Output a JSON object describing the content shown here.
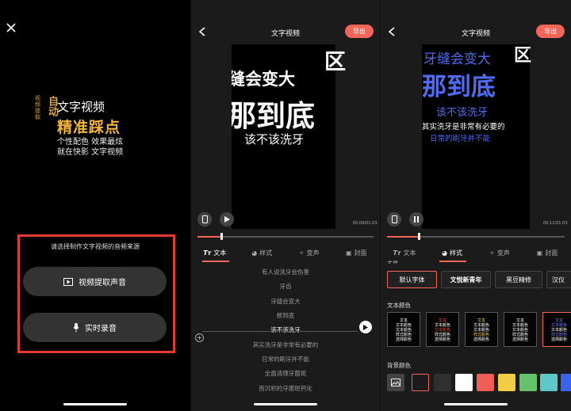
{
  "panel1": {
    "close_icon": "close-icon",
    "tag_small": "视频提取",
    "tag_logo": "自动",
    "headline1": "文字视频",
    "headline2": "精准踩点",
    "line3": "个性配色 效果最炫",
    "line4": "就在快影 文字视频",
    "hint": "请选择制作文字视频的音频来源",
    "btn_extract": "视频提取声音",
    "btn_record": "实时录音"
  },
  "editor": {
    "title": "文字视频",
    "export_label": "导出"
  },
  "panel2": {
    "preview_lines": [
      "缝会变大",
      "那到底",
      "该不该洗牙"
    ],
    "corner_char": "区",
    "time": "00:09/01:03",
    "tabs": [
      "文本",
      "样式",
      "变声",
      "封面"
    ],
    "lyrics": [
      "有人说洗牙会伤害",
      "牙齿",
      "牙缝会变大",
      "那到底",
      "该不该洗牙",
      "其实洗牙是非常有必要的",
      "日常的刷牙并不能",
      "全面清理牙菌斑",
      "而沉积的牙菌斑钙化"
    ],
    "current_lyric_index": 4
  },
  "panel3": {
    "preview_lines": [
      "牙缝会变大",
      "那到底",
      "该不该洗牙",
      "其实洗牙是非常有必要的",
      "日常的刷牙并不能"
    ],
    "corner_char": "区",
    "time": "00:11/01:03",
    "tabs": [
      "文本",
      "样式",
      "变声",
      "封面"
    ],
    "section_font_label": "字体",
    "fonts": [
      "默认字体",
      "文悦新青年",
      "黑豆精修",
      "汉仪"
    ],
    "section_color_label": "文本颜色",
    "color_swatch_text": [
      "文本",
      "文本颜色",
      "文本颜色",
      "样式颜色",
      "选择颜色"
    ],
    "section_bg_label": "背景颜色",
    "bg_colors": [
      "#000000",
      "#2f2f2f",
      "#ffffff",
      "#ef5d54",
      "#f1cd45",
      "#66c26a",
      "#5ec8c8",
      "#3b63e8"
    ]
  }
}
